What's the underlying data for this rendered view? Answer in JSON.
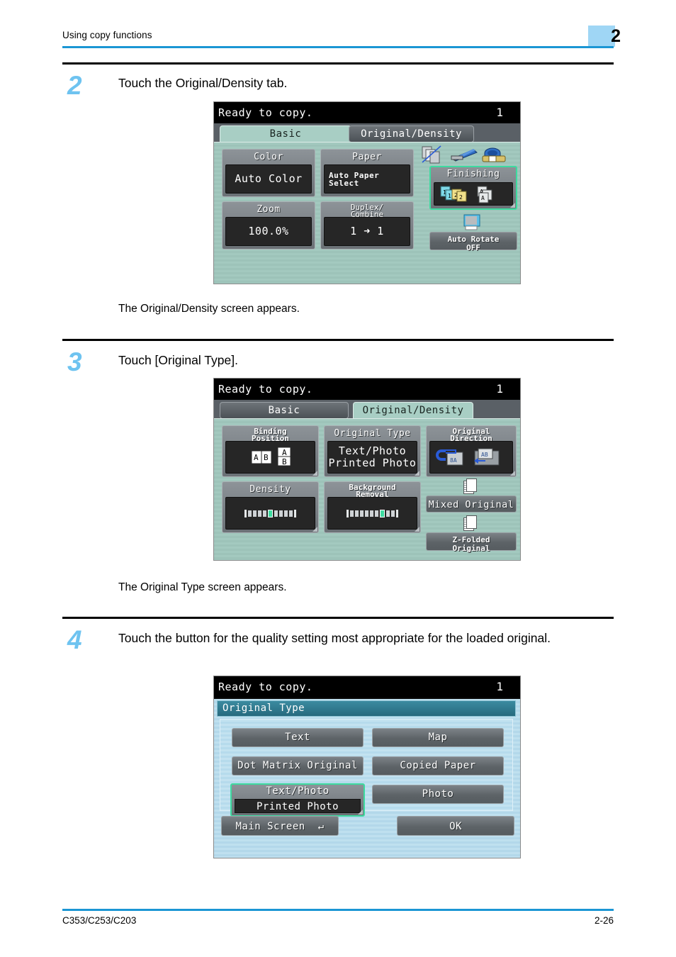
{
  "header": {
    "title": "Using copy functions",
    "chapter": "2"
  },
  "footer": {
    "model": "C353/C253/C203",
    "page": "2-26"
  },
  "steps": [
    {
      "number": "2",
      "instruction": "Touch the Original/Density tab.",
      "result": "The Original/Density screen appears."
    },
    {
      "number": "3",
      "instruction": "Touch [Original Type].",
      "result": "The Original Type screen appears."
    },
    {
      "number": "4",
      "instruction": "Touch the button for the quality setting most appropriate for the loaded original.",
      "result": ""
    }
  ],
  "screens": [
    {
      "status": "Ready to copy.",
      "count": "1",
      "tabs": [
        {
          "label": "Basic",
          "state": "active"
        },
        {
          "label": "Original/Density",
          "state": "inactive"
        }
      ],
      "cards": [
        {
          "label": "Color",
          "value": [
            "Auto Color"
          ]
        },
        {
          "label": "Paper",
          "value": [
            "Auto Paper",
            "Select"
          ]
        },
        {
          "label": "Zoom",
          "value": [
            "100.0%"
          ]
        },
        {
          "label": "Duplex/",
          "label2": "Combine",
          "value": [
            "1  ➜  1"
          ]
        }
      ],
      "finishing": {
        "label": "Finishing",
        "selected": true
      },
      "auto_rotate": {
        "label": "Auto Rotate",
        "label2": "OFF"
      },
      "icons": [
        "sort-pages-icon",
        "stapler-icon",
        "hole-punch-icon",
        "rotate-page-icon"
      ]
    },
    {
      "status": "Ready to copy.",
      "count": "1",
      "tabs": [
        {
          "label": "Basic",
          "state": "inactive"
        },
        {
          "label": "Original/Density",
          "state": "active"
        }
      ],
      "cards": [
        {
          "label": "Binding",
          "label2": "Position",
          "value": []
        },
        {
          "label": "Original Type",
          "value": [
            "Text/Photo",
            "Printed Photo"
          ]
        },
        {
          "label": "Original",
          "label2": "Direction",
          "value": []
        },
        {
          "label": "Density",
          "value": []
        },
        {
          "label": "Background",
          "label2": "Removal",
          "value": []
        }
      ],
      "side_buttons": [
        {
          "label": "Mixed Original"
        },
        {
          "label": "Z-Folded",
          "label2": "Original"
        }
      ],
      "density_pips": {
        "total": 9,
        "current": 5
      },
      "background_pips": {
        "total": 9,
        "current": 7
      }
    },
    {
      "status": "Ready to copy.",
      "count": "1",
      "dialog_title": "Original Type",
      "options_left": [
        {
          "label": "Text",
          "selected": false
        },
        {
          "label": "Dot Matrix Original",
          "selected": false
        },
        {
          "label": "Text/Photo",
          "label2": "Printed Photo",
          "selected": true
        }
      ],
      "options_right": [
        {
          "label": "Map",
          "selected": false
        },
        {
          "label": "Copied Paper",
          "selected": false
        },
        {
          "label": "Photo",
          "selected": false
        }
      ],
      "main_screen_button": "Main Screen",
      "ok_button": "OK"
    }
  ],
  "colors": {
    "accent_rule": "#1b96d4",
    "chapter_badge": "#9fd6f5",
    "step_number": "#6ec3f0",
    "lcd_green": "#a3c9bf",
    "lcd_blue": "#bfe0ef",
    "dialog_header": "#2d7b8e",
    "selection_outline": "#3ddba0"
  }
}
